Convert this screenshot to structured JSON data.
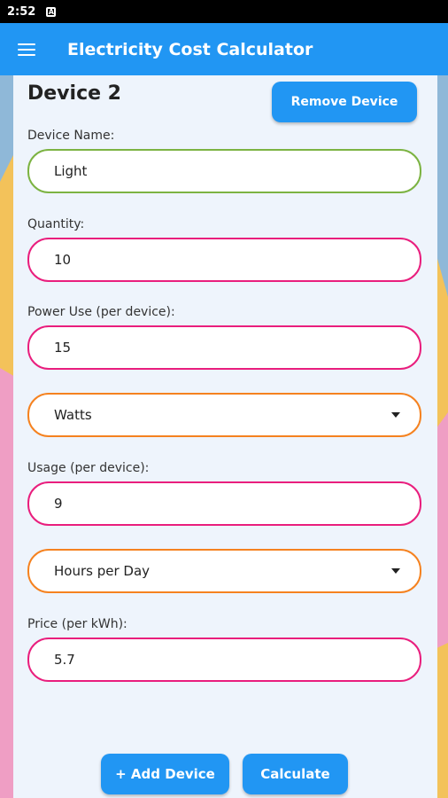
{
  "status_bar": {
    "time": "2:52",
    "notification_icon": "a-icon"
  },
  "app_bar": {
    "menu_icon": "hamburger-menu-icon",
    "title": "Electricity Cost Calculator"
  },
  "device": {
    "title": "Device 2",
    "remove_label": "Remove Device",
    "name_label": "Device Name:",
    "name_value": "Light",
    "quantity_label": "Quantity:",
    "quantity_value": "10",
    "power_label": "Power Use (per device):",
    "power_value": "15",
    "power_unit": "Watts",
    "usage_label": "Usage (per device):",
    "usage_value": "9",
    "usage_unit": "Hours per Day",
    "price_label": "Price (per kWh):",
    "price_value": "5.7"
  },
  "actions": {
    "add_label": "+ Add Device",
    "calculate_label": "Calculate"
  },
  "colors": {
    "primary": "#2196f3",
    "field_border_pink": "#e91e7d",
    "field_border_green": "#7cb342",
    "field_border_orange": "#f58220",
    "card_bg": "#eef4fc"
  }
}
